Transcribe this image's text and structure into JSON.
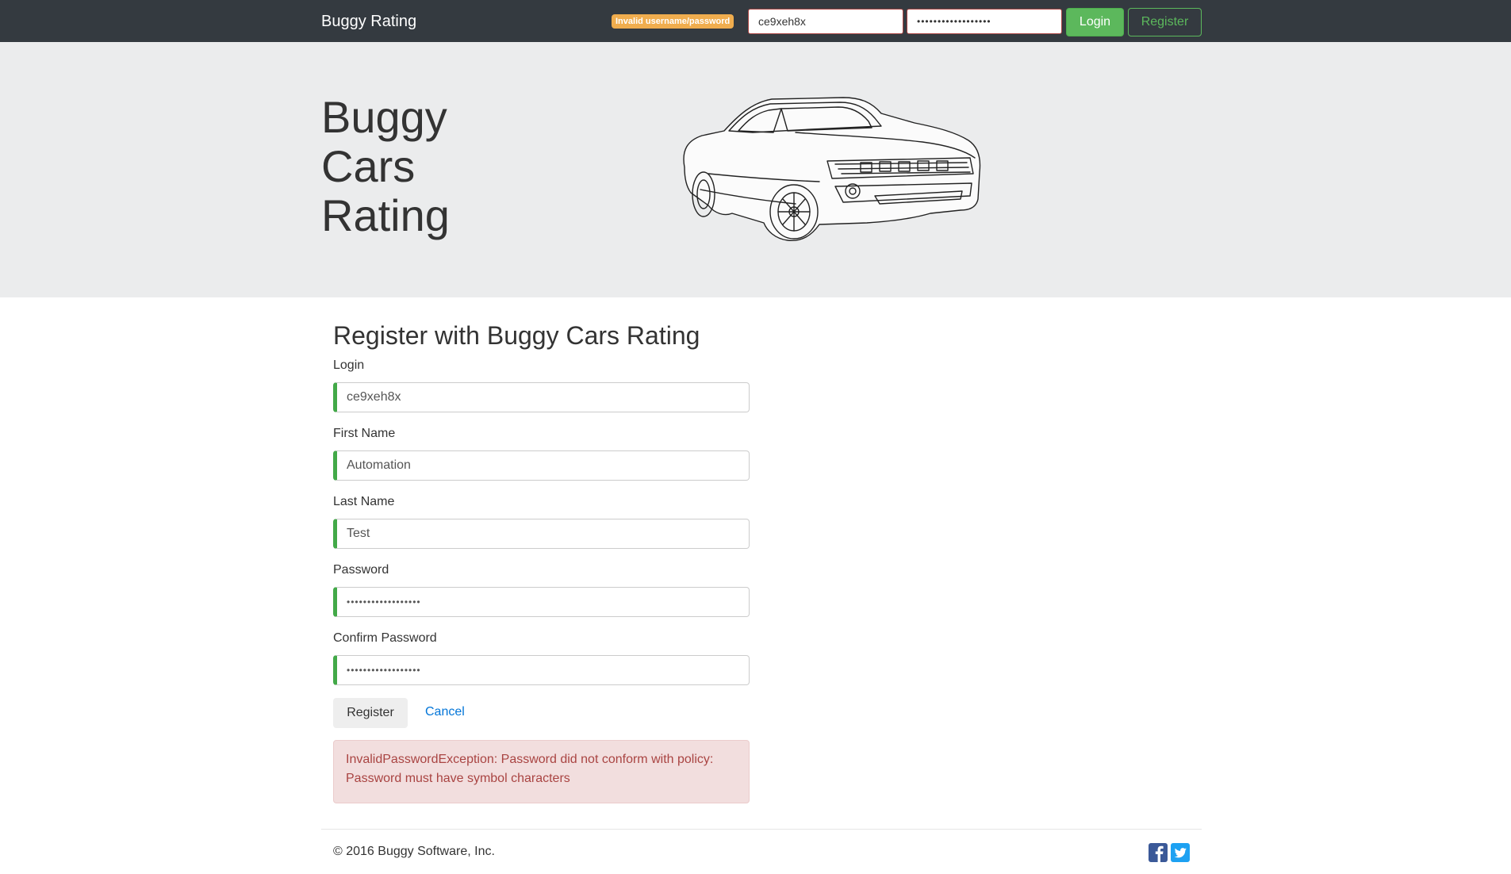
{
  "navbar": {
    "brand": "Buggy Rating",
    "error_badge": "Invalid username/password",
    "login_value": "ce9xeh8x",
    "password_value": "••••••••••••••••••",
    "login_button": "Login",
    "register_button": "Register"
  },
  "jumbotron": {
    "title": "Buggy\nCars\nRating",
    "image_icon": "sports-car-illustration"
  },
  "form": {
    "title": "Register with Buggy Cars Rating",
    "fields": [
      {
        "label": "Login",
        "value": "ce9xeh8x"
      },
      {
        "label": "First Name",
        "value": "Automation"
      },
      {
        "label": "Last Name",
        "value": "Test"
      },
      {
        "label": "Password",
        "value": "••••••••••••••••••"
      },
      {
        "label": "Confirm Password",
        "value": "••••••••••••••••••"
      }
    ],
    "register_button": "Register",
    "cancel_link": "Cancel",
    "error_message": "InvalidPasswordException: Password did not conform with policy: Password must have symbol characters"
  },
  "footer": {
    "copyright": "© 2016 Buggy Software, Inc.",
    "social_icons": [
      "facebook-icon",
      "twitter-icon"
    ]
  },
  "colors": {
    "navbar_bg": "#343a40",
    "jumbotron_bg": "#ebeced",
    "success": "#5cb85c",
    "warning": "#f0ad4e",
    "danger_text": "#a94442",
    "danger_bg": "#f2dede",
    "link": "#0275d8",
    "valid_border": "#42a948"
  }
}
